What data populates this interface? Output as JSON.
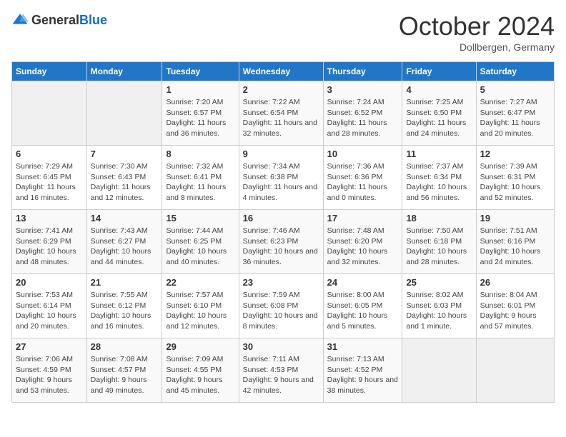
{
  "header": {
    "logo_general": "General",
    "logo_blue": "Blue",
    "month_title": "October 2024",
    "subtitle": "Dollbergen, Germany"
  },
  "weekdays": [
    "Sunday",
    "Monday",
    "Tuesday",
    "Wednesday",
    "Thursday",
    "Friday",
    "Saturday"
  ],
  "weeks": [
    [
      {
        "day": "",
        "sunrise": "",
        "sunset": "",
        "daylight": ""
      },
      {
        "day": "",
        "sunrise": "",
        "sunset": "",
        "daylight": ""
      },
      {
        "day": "1",
        "sunrise": "Sunrise: 7:20 AM",
        "sunset": "Sunset: 6:57 PM",
        "daylight": "Daylight: 11 hours and 36 minutes."
      },
      {
        "day": "2",
        "sunrise": "Sunrise: 7:22 AM",
        "sunset": "Sunset: 6:54 PM",
        "daylight": "Daylight: 11 hours and 32 minutes."
      },
      {
        "day": "3",
        "sunrise": "Sunrise: 7:24 AM",
        "sunset": "Sunset: 6:52 PM",
        "daylight": "Daylight: 11 hours and 28 minutes."
      },
      {
        "day": "4",
        "sunrise": "Sunrise: 7:25 AM",
        "sunset": "Sunset: 6:50 PM",
        "daylight": "Daylight: 11 hours and 24 minutes."
      },
      {
        "day": "5",
        "sunrise": "Sunrise: 7:27 AM",
        "sunset": "Sunset: 6:47 PM",
        "daylight": "Daylight: 11 hours and 20 minutes."
      }
    ],
    [
      {
        "day": "6",
        "sunrise": "Sunrise: 7:29 AM",
        "sunset": "Sunset: 6:45 PM",
        "daylight": "Daylight: 11 hours and 16 minutes."
      },
      {
        "day": "7",
        "sunrise": "Sunrise: 7:30 AM",
        "sunset": "Sunset: 6:43 PM",
        "daylight": "Daylight: 11 hours and 12 minutes."
      },
      {
        "day": "8",
        "sunrise": "Sunrise: 7:32 AM",
        "sunset": "Sunset: 6:41 PM",
        "daylight": "Daylight: 11 hours and 8 minutes."
      },
      {
        "day": "9",
        "sunrise": "Sunrise: 7:34 AM",
        "sunset": "Sunset: 6:38 PM",
        "daylight": "Daylight: 11 hours and 4 minutes."
      },
      {
        "day": "10",
        "sunrise": "Sunrise: 7:36 AM",
        "sunset": "Sunset: 6:36 PM",
        "daylight": "Daylight: 11 hours and 0 minutes."
      },
      {
        "day": "11",
        "sunrise": "Sunrise: 7:37 AM",
        "sunset": "Sunset: 6:34 PM",
        "daylight": "Daylight: 10 hours and 56 minutes."
      },
      {
        "day": "12",
        "sunrise": "Sunrise: 7:39 AM",
        "sunset": "Sunset: 6:31 PM",
        "daylight": "Daylight: 10 hours and 52 minutes."
      }
    ],
    [
      {
        "day": "13",
        "sunrise": "Sunrise: 7:41 AM",
        "sunset": "Sunset: 6:29 PM",
        "daylight": "Daylight: 10 hours and 48 minutes."
      },
      {
        "day": "14",
        "sunrise": "Sunrise: 7:43 AM",
        "sunset": "Sunset: 6:27 PM",
        "daylight": "Daylight: 10 hours and 44 minutes."
      },
      {
        "day": "15",
        "sunrise": "Sunrise: 7:44 AM",
        "sunset": "Sunset: 6:25 PM",
        "daylight": "Daylight: 10 hours and 40 minutes."
      },
      {
        "day": "16",
        "sunrise": "Sunrise: 7:46 AM",
        "sunset": "Sunset: 6:23 PM",
        "daylight": "Daylight: 10 hours and 36 minutes."
      },
      {
        "day": "17",
        "sunrise": "Sunrise: 7:48 AM",
        "sunset": "Sunset: 6:20 PM",
        "daylight": "Daylight: 10 hours and 32 minutes."
      },
      {
        "day": "18",
        "sunrise": "Sunrise: 7:50 AM",
        "sunset": "Sunset: 6:18 PM",
        "daylight": "Daylight: 10 hours and 28 minutes."
      },
      {
        "day": "19",
        "sunrise": "Sunrise: 7:51 AM",
        "sunset": "Sunset: 6:16 PM",
        "daylight": "Daylight: 10 hours and 24 minutes."
      }
    ],
    [
      {
        "day": "20",
        "sunrise": "Sunrise: 7:53 AM",
        "sunset": "Sunset: 6:14 PM",
        "daylight": "Daylight: 10 hours and 20 minutes."
      },
      {
        "day": "21",
        "sunrise": "Sunrise: 7:55 AM",
        "sunset": "Sunset: 6:12 PM",
        "daylight": "Daylight: 10 hours and 16 minutes."
      },
      {
        "day": "22",
        "sunrise": "Sunrise: 7:57 AM",
        "sunset": "Sunset: 6:10 PM",
        "daylight": "Daylight: 10 hours and 12 minutes."
      },
      {
        "day": "23",
        "sunrise": "Sunrise: 7:59 AM",
        "sunset": "Sunset: 6:08 PM",
        "daylight": "Daylight: 10 hours and 8 minutes."
      },
      {
        "day": "24",
        "sunrise": "Sunrise: 8:00 AM",
        "sunset": "Sunset: 6:05 PM",
        "daylight": "Daylight: 10 hours and 5 minutes."
      },
      {
        "day": "25",
        "sunrise": "Sunrise: 8:02 AM",
        "sunset": "Sunset: 6:03 PM",
        "daylight": "Daylight: 10 hours and 1 minute."
      },
      {
        "day": "26",
        "sunrise": "Sunrise: 8:04 AM",
        "sunset": "Sunset: 6:01 PM",
        "daylight": "Daylight: 9 hours and 57 minutes."
      }
    ],
    [
      {
        "day": "27",
        "sunrise": "Sunrise: 7:06 AM",
        "sunset": "Sunset: 4:59 PM",
        "daylight": "Daylight: 9 hours and 53 minutes."
      },
      {
        "day": "28",
        "sunrise": "Sunrise: 7:08 AM",
        "sunset": "Sunset: 4:57 PM",
        "daylight": "Daylight: 9 hours and 49 minutes."
      },
      {
        "day": "29",
        "sunrise": "Sunrise: 7:09 AM",
        "sunset": "Sunset: 4:55 PM",
        "daylight": "Daylight: 9 hours and 45 minutes."
      },
      {
        "day": "30",
        "sunrise": "Sunrise: 7:11 AM",
        "sunset": "Sunset: 4:53 PM",
        "daylight": "Daylight: 9 hours and 42 minutes."
      },
      {
        "day": "31",
        "sunrise": "Sunrise: 7:13 AM",
        "sunset": "Sunset: 4:52 PM",
        "daylight": "Daylight: 9 hours and 38 minutes."
      },
      {
        "day": "",
        "sunrise": "",
        "sunset": "",
        "daylight": ""
      },
      {
        "day": "",
        "sunrise": "",
        "sunset": "",
        "daylight": ""
      }
    ]
  ]
}
